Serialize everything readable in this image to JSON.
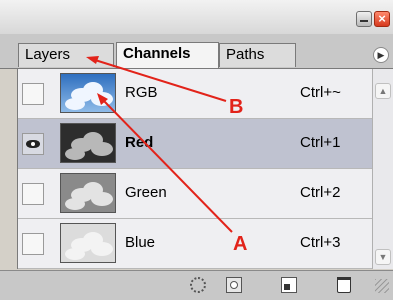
{
  "window": {
    "close_glyph": "×"
  },
  "tabs": [
    {
      "label": "Layers",
      "active": false
    },
    {
      "label": "Channels",
      "active": true
    },
    {
      "label": "Paths",
      "active": false
    }
  ],
  "panel_menu_glyph": "▶",
  "channels": [
    {
      "name": "RGB",
      "shortcut": "Ctrl+~",
      "visible": false,
      "selected": false,
      "thumbnail": "sky-clouds-color"
    },
    {
      "name": "Red",
      "shortcut": "Ctrl+1",
      "visible": true,
      "selected": true,
      "thumbnail": "clouds-dark"
    },
    {
      "name": "Green",
      "shortcut": "Ctrl+2",
      "visible": false,
      "selected": false,
      "thumbnail": "clouds-mid"
    },
    {
      "name": "Blue",
      "shortcut": "Ctrl+3",
      "visible": false,
      "selected": false,
      "thumbnail": "clouds-light"
    }
  ],
  "scrollbar": {
    "up_glyph": "▲",
    "down_glyph": "▼"
  },
  "toolbar": {
    "icons": [
      "load-selection-icon",
      "save-selection-icon",
      "new-channel-icon",
      "trash-icon"
    ]
  },
  "annotations": {
    "label_a": "A",
    "label_b": "B",
    "color": "#e2231a"
  },
  "colors": {
    "selected_row": "#bfc2d0",
    "row": "#efeff2",
    "close_button": "#d6391d"
  }
}
